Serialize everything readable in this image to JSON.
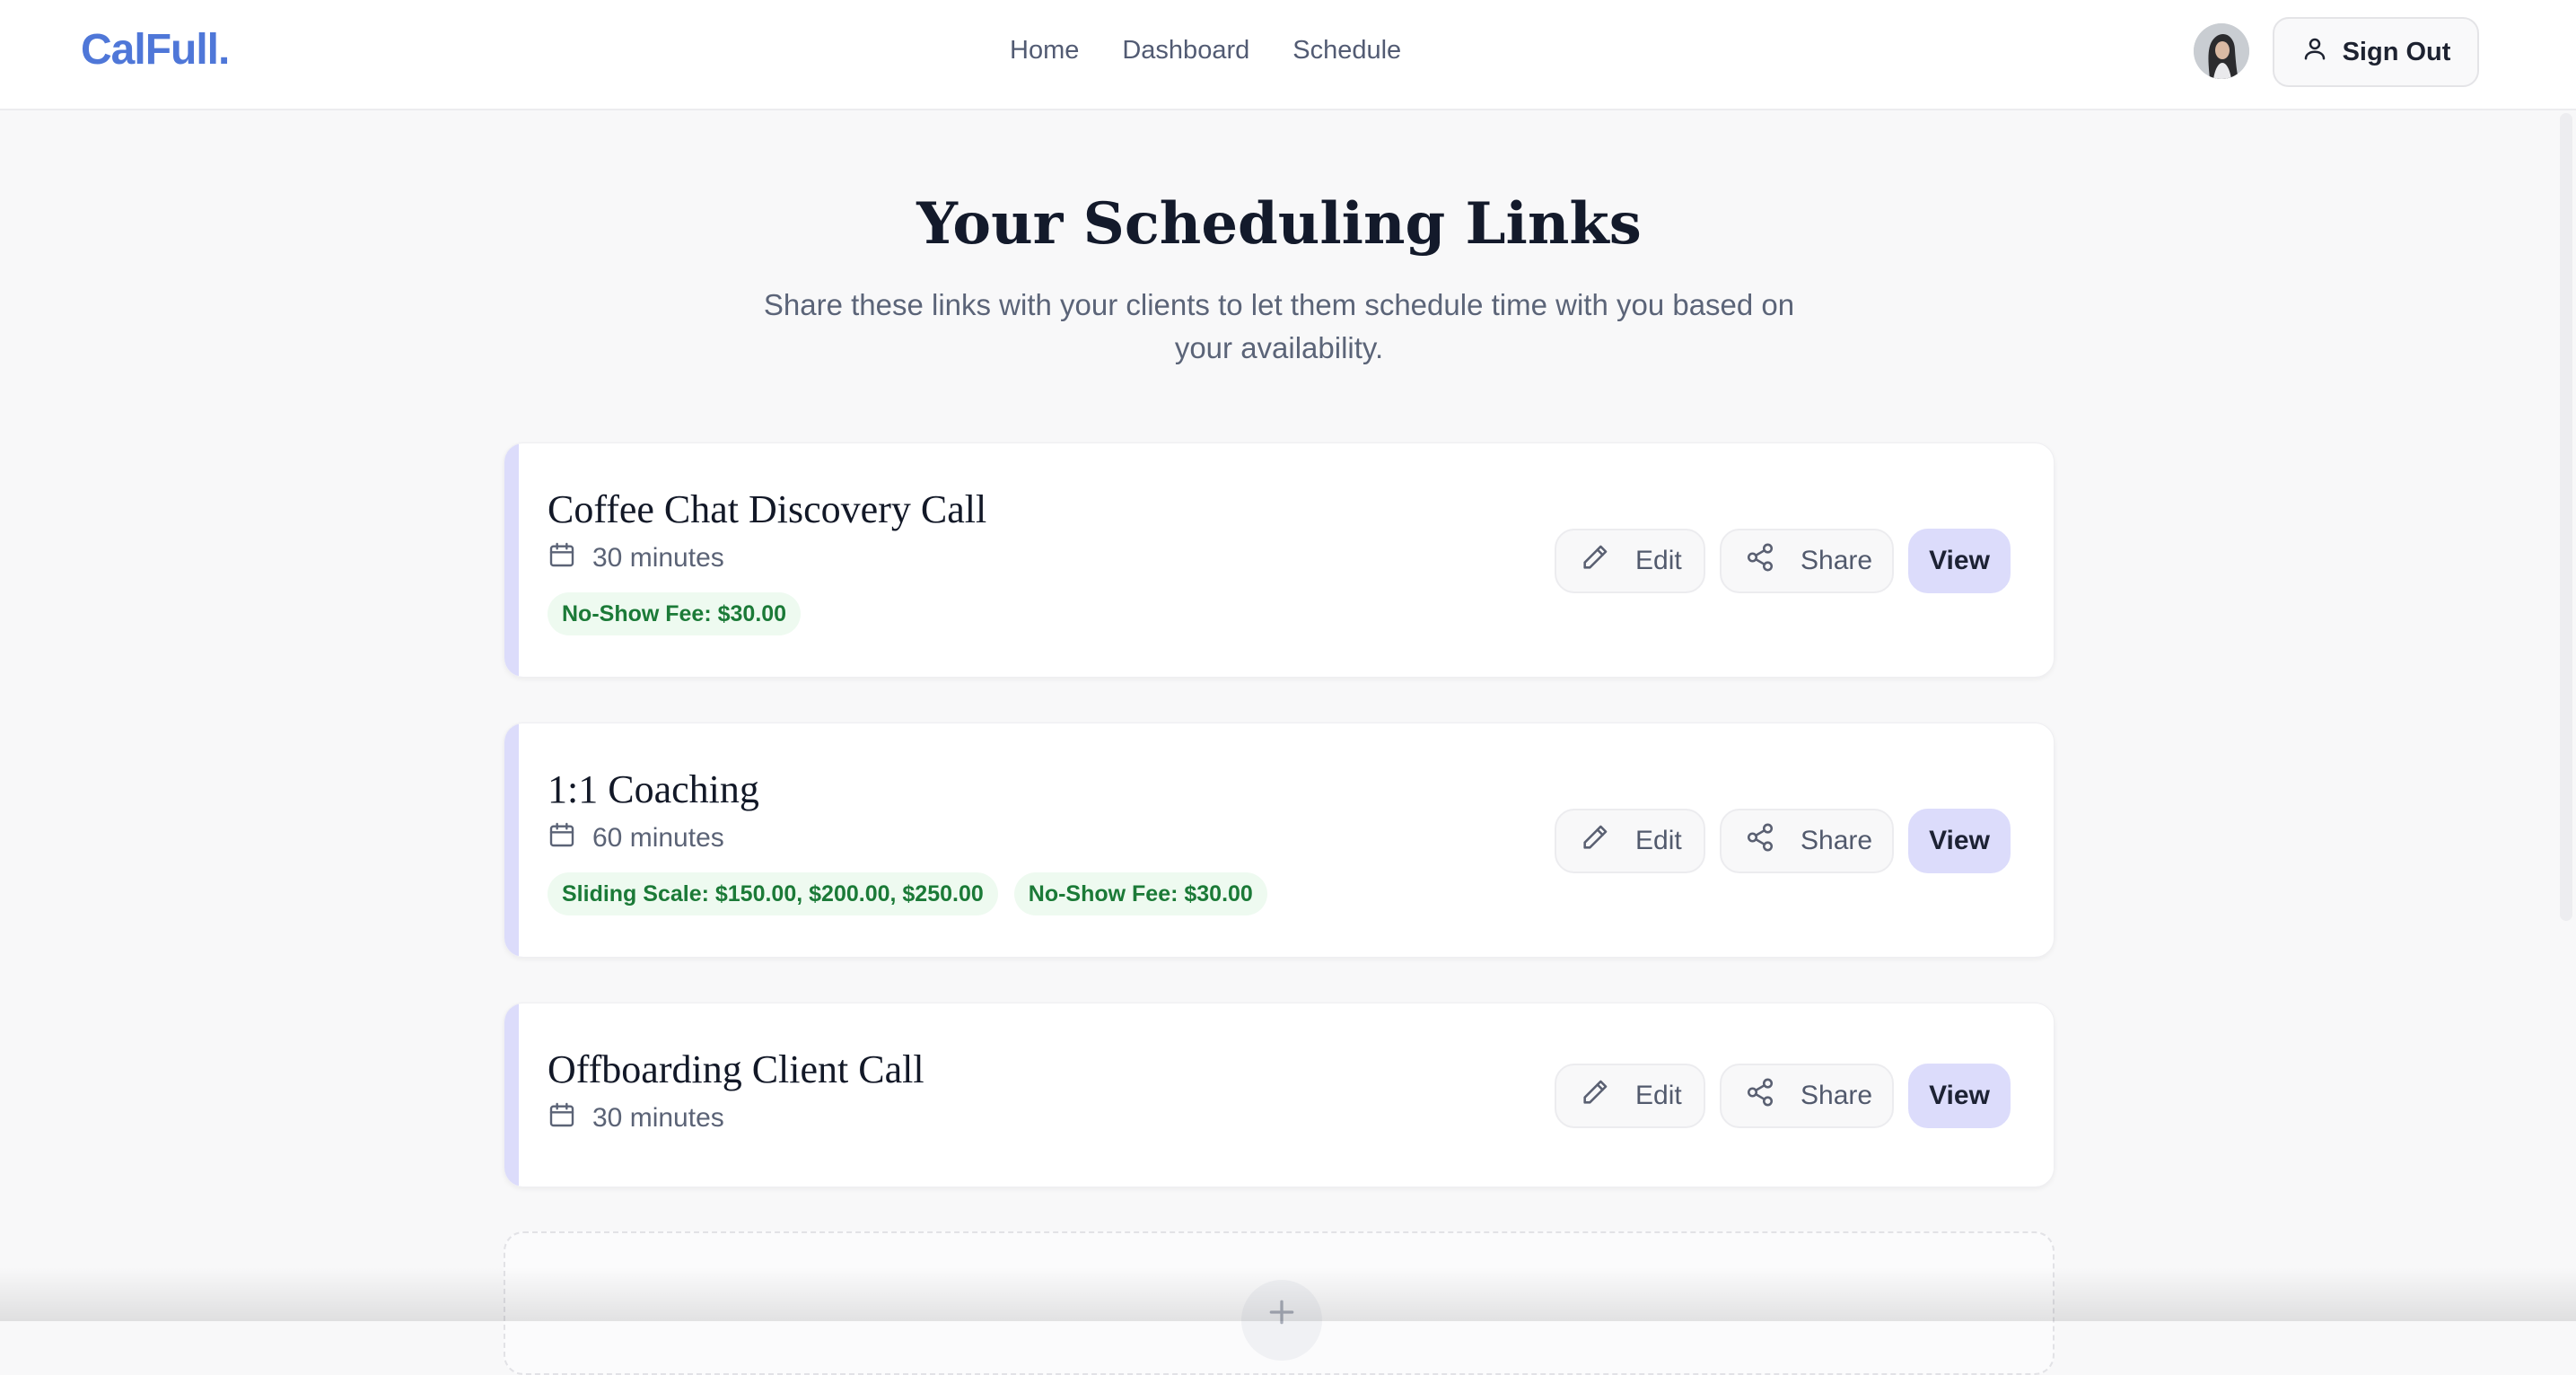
{
  "header": {
    "logo": "CalFull.",
    "nav": [
      "Home",
      "Dashboard",
      "Schedule"
    ],
    "sign_out_label": "Sign Out"
  },
  "main": {
    "title": "Your Scheduling Links",
    "subtitle": "Share these links with your clients to let them schedule time with you based on your availability."
  },
  "cards": [
    {
      "title": "Coffee Chat Discovery Call",
      "duration": "30 minutes",
      "tags": [
        "No-Show Fee: $30.00"
      ]
    },
    {
      "title": "1:1 Coaching",
      "duration": "60 minutes",
      "tags": [
        "Sliding Scale: $150.00, $200.00, $250.00",
        "No-Show Fee: $30.00"
      ]
    },
    {
      "title": "Offboarding Client Call",
      "duration": "30 minutes",
      "tags": []
    }
  ],
  "actions": {
    "edit": "Edit",
    "share": "Share",
    "view": "View"
  },
  "colors": {
    "brand": "#4f77d8",
    "accent": "#dcdcfb",
    "tag_bg": "#eefaf0",
    "tag_text": "#1b7a37"
  }
}
